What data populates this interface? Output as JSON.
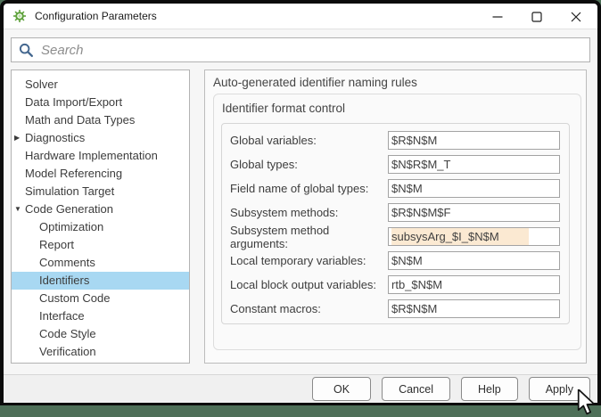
{
  "window": {
    "title": "Configuration Parameters",
    "controls": {
      "minimize": "minimize",
      "maximize": "maximize",
      "close": "close"
    }
  },
  "search": {
    "placeholder": "Search"
  },
  "sidebar": {
    "items": [
      {
        "label": "Solver",
        "level": 0
      },
      {
        "label": "Data Import/Export",
        "level": 0
      },
      {
        "label": "Math and Data Types",
        "level": 0
      },
      {
        "label": "Diagnostics",
        "level": 0,
        "arrow": "collapsed"
      },
      {
        "label": "Hardware Implementation",
        "level": 0
      },
      {
        "label": "Model Referencing",
        "level": 0
      },
      {
        "label": "Simulation Target",
        "level": 0
      },
      {
        "label": "Code Generation",
        "level": 0,
        "arrow": "expanded"
      },
      {
        "label": "Optimization",
        "level": 1
      },
      {
        "label": "Report",
        "level": 1
      },
      {
        "label": "Comments",
        "level": 1
      },
      {
        "label": "Identifiers",
        "level": 1,
        "selected": true
      },
      {
        "label": "Custom Code",
        "level": 1
      },
      {
        "label": "Interface",
        "level": 1
      },
      {
        "label": "Code Style",
        "level": 1
      },
      {
        "label": "Verification",
        "level": 1
      }
    ]
  },
  "main": {
    "heading": "Auto-generated identifier naming rules",
    "section_title": "Identifier format control",
    "fields": [
      {
        "label": "Global variables:",
        "value": "$R$N$M",
        "modified": false
      },
      {
        "label": "Global types:",
        "value": "$N$R$M_T",
        "modified": false
      },
      {
        "label": "Field name of global types:",
        "value": "$N$M",
        "modified": false
      },
      {
        "label": "Subsystem methods:",
        "value": "$R$N$M$F",
        "modified": false
      },
      {
        "label": "Subsystem method arguments:",
        "value": "subsysArg_$I_$N$M",
        "modified": true
      },
      {
        "label": "Local temporary variables:",
        "value": "$N$M",
        "modified": false
      },
      {
        "label": "Local block output variables:",
        "value": "rtb_$N$M",
        "modified": false
      },
      {
        "label": "Constant macros:",
        "value": "$R$N$M",
        "modified": false
      }
    ]
  },
  "footer": {
    "buttons": [
      "OK",
      "Cancel",
      "Help",
      "Apply"
    ]
  },
  "colors": {
    "selection_blue": "#a8d8f2",
    "modified_field_bg": "#fbe9d2",
    "desktop_green": "#4e6f58",
    "app_icon_green": "#5fa23c",
    "search_icon_blue": "#44678f"
  }
}
